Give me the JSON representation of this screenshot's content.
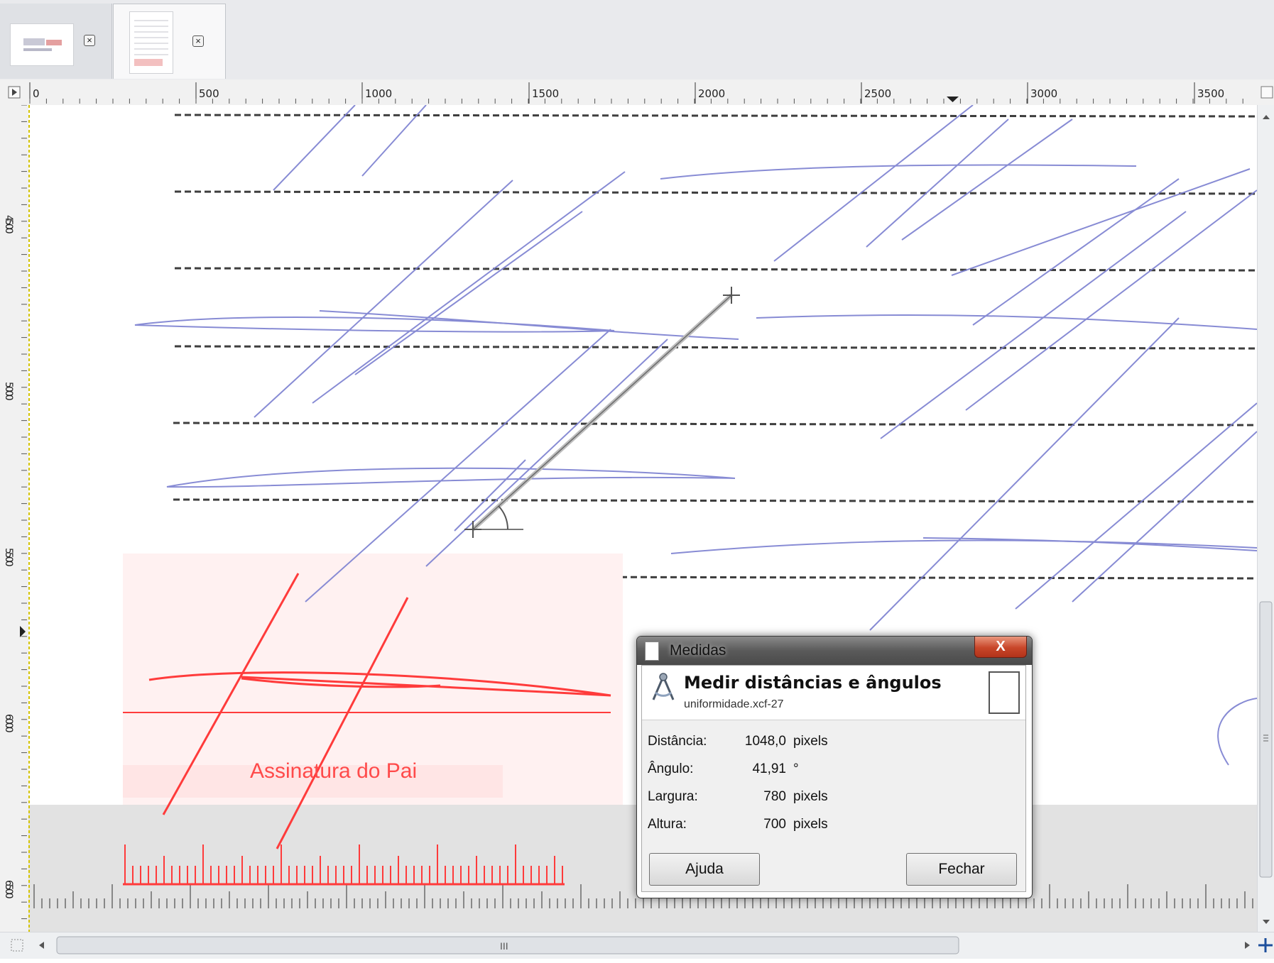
{
  "tabs": [
    {
      "name": "image-tab-1",
      "close": "×"
    },
    {
      "name": "image-tab-2",
      "close": "×"
    }
  ],
  "ruler": {
    "h_labels": [
      "0",
      "500",
      "1000",
      "1500",
      "2000",
      "2500",
      "3000",
      "3500"
    ],
    "v_labels": [
      "4500",
      "5000",
      "5500",
      "6000",
      "6500"
    ]
  },
  "canvas": {
    "overlay_text": "Assinatura do Pai",
    "ink_color": "#7b7fd0",
    "red_color": "#ff3b3b"
  },
  "dialog": {
    "title": "Medidas",
    "close_glyph": "X",
    "heading": "Medir distâncias e ângulos",
    "subheading": "uniformidade.xcf-27",
    "rows": [
      {
        "label": "Distância:",
        "value": "1048,0",
        "unit": "pixels"
      },
      {
        "label": "Ângulo:",
        "value": "41,91",
        "unit": "°"
      },
      {
        "label": "Largura:",
        "value": "780",
        "unit": "pixels"
      },
      {
        "label": "Altura:",
        "value": "700",
        "unit": "pixels"
      }
    ],
    "help_button": "Ajuda",
    "close_button": "Fechar"
  },
  "scrollbar": {
    "thumb_glyph": "III"
  }
}
